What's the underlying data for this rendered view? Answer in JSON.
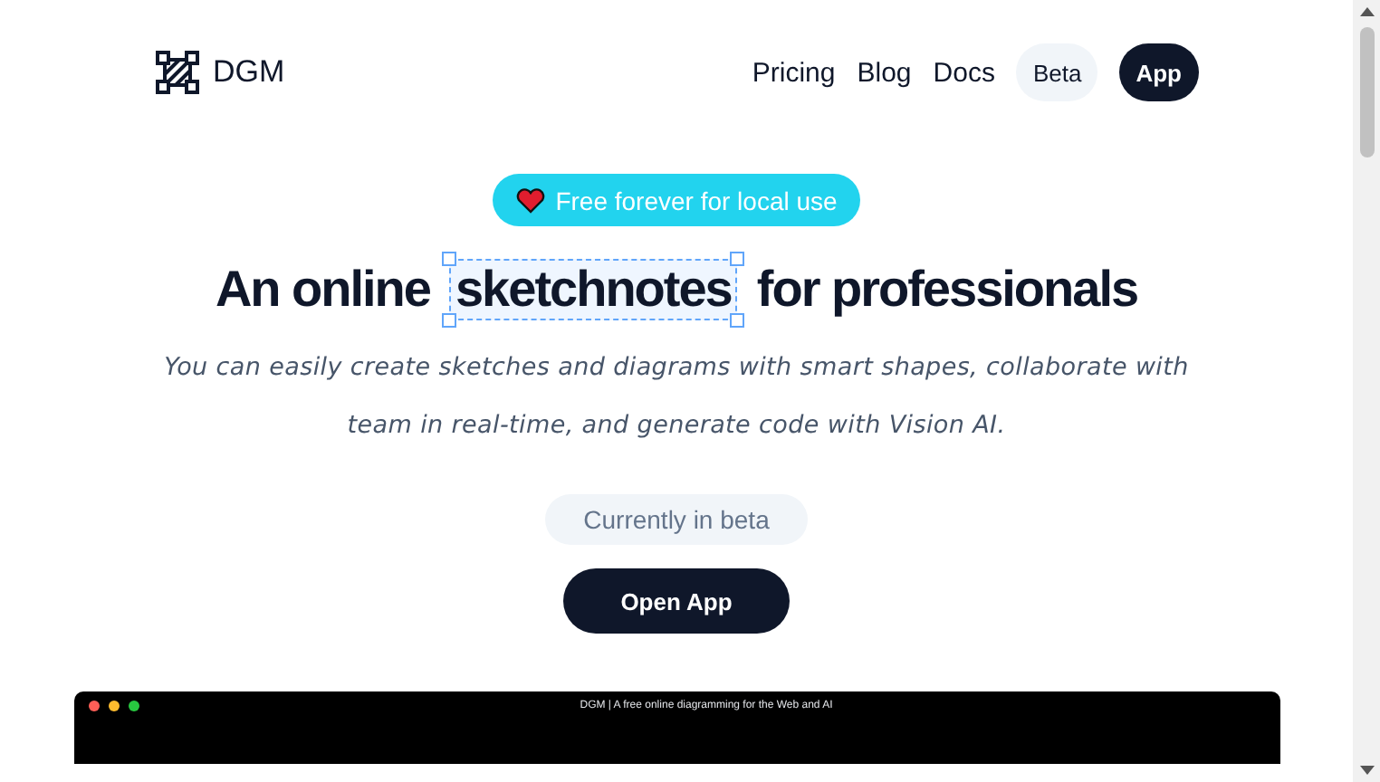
{
  "brand": {
    "name": "DGM"
  },
  "nav": {
    "links": [
      "Pricing",
      "Blog",
      "Docs"
    ],
    "beta": "Beta",
    "app": "App"
  },
  "hero": {
    "badge": "Free forever for local use",
    "headline": {
      "before": "An online",
      "highlight": "sketchnotes",
      "after": "for professionals"
    },
    "subtitle": "You can easily create sketches and diagrams with smart shapes, collaborate with team in real-time, and generate code with Vision AI.",
    "status": "Currently in beta",
    "cta": "Open App"
  },
  "preview": {
    "title": "DGM | A free online diagramming for the Web and AI"
  }
}
